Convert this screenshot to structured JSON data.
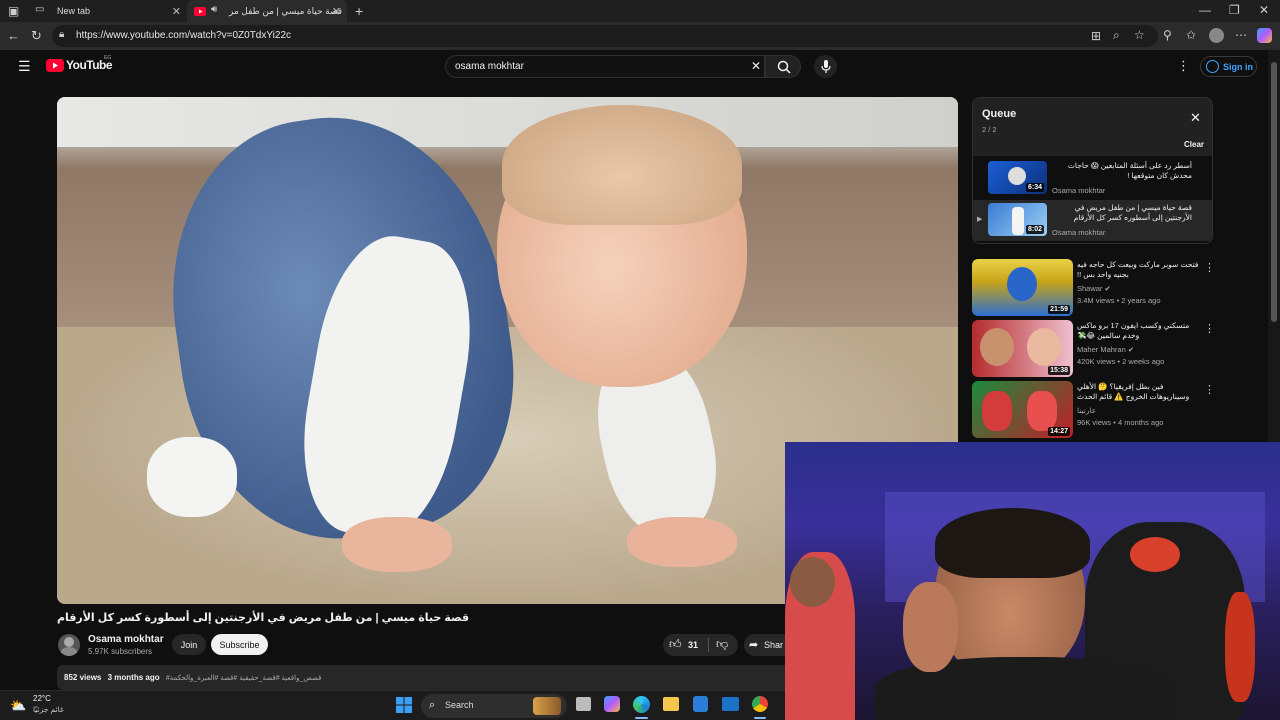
{
  "browser": {
    "tabs": [
      {
        "label": "New tab"
      },
      {
        "label": "قصة حياة ميسي | من طفل مر"
      }
    ],
    "url": "https://www.youtube.com/watch?v=0Z0TdxYi22c"
  },
  "youtube": {
    "logo_text": "YouTube",
    "region": "EG",
    "search_value": "osama mokhtar",
    "sign_in": "Sign in"
  },
  "video": {
    "title": "قصة حياة ميسي | من طفل مريض في الأرجنتين إلى أسطورة كسر كل الأرقام",
    "channel": "Osama mokhtar",
    "subscribers": "5.97K subscribers",
    "join": "Join",
    "subscribe": "Subscribe",
    "likes": "31",
    "share": "Shar",
    "views": "852 views",
    "date": "3 months ago",
    "tags": "#قصص_واقعية #قصة_حقيقية #قصة #العبرة_والحكمة"
  },
  "queue": {
    "title": "Queue",
    "count": "2 / 2",
    "clear": "Clear",
    "items": [
      {
        "title": "أسطر رد على أسئلة المتابعين 😱 حاجات محدش كان متوقعها !",
        "channel": "Osama mokhtar",
        "duration": "6:34"
      },
      {
        "title": "قصة حياة ميسي | من طفل مريض في الأرجنتين إلى أسطوره كسر كل الأرقام",
        "channel": "Osama mokhtar",
        "duration": "8:02"
      }
    ]
  },
  "recommendations": [
    {
      "title": "فتحت سوبر ماركت وبيعت كل حاجه فيه بجنيه واحد بس !!",
      "channel": "Shawar",
      "meta": "3.4M views • 2 years ago",
      "duration": "21:59"
    },
    {
      "title": "متسكني وكسب ايفون 17 برو ماكس وخدم سالمين 😂💸",
      "channel": "Maher Mahran",
      "meta": "420K views • 2 weeks ago",
      "duration": "15:38"
    },
    {
      "title": "فين بطل إفريقيا؟ 🤔 الأهلي وسيناريوهات الخروج ⚠️ قائم الحدث البرازيلية 🇧🇷 ...",
      "channel": "عارتينا",
      "meta": "96K views • 4 months ago",
      "duration": "14:27"
    }
  ],
  "taskbar": {
    "weather_temp": "22°C",
    "weather_desc": "غائم جزئيًا",
    "search": "Search"
  },
  "colors": {
    "yt_red": "#ff0033",
    "link_blue": "#3ea6ff",
    "bg": "#0f0f0f"
  }
}
